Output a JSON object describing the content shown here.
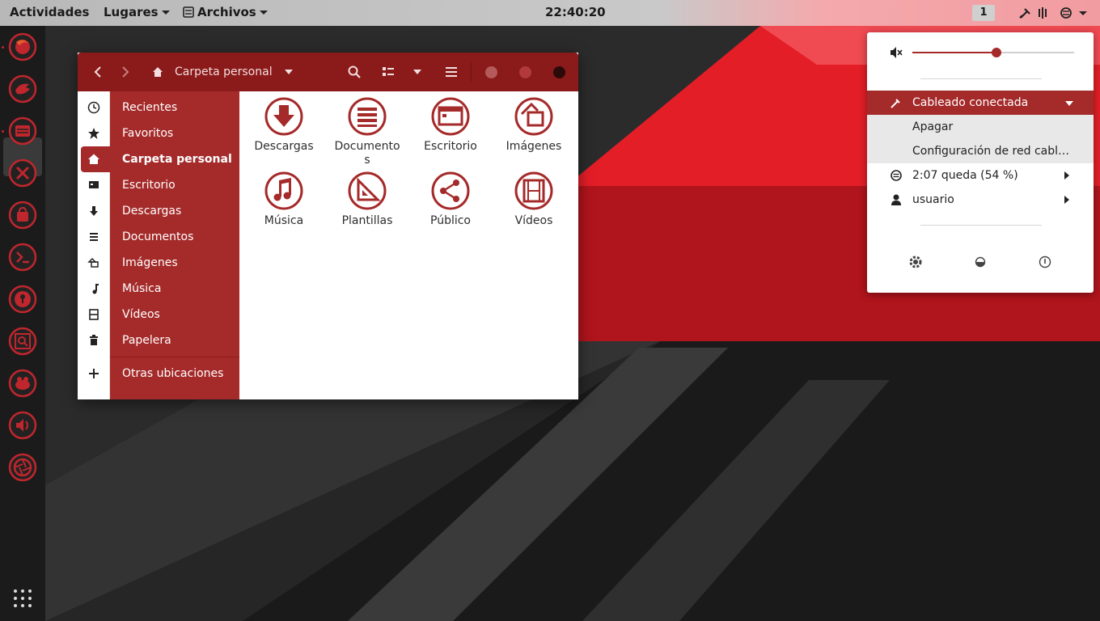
{
  "topbar": {
    "activities": "Actividades",
    "places": "Lugares",
    "app_menu": "Archivos",
    "clock": "22:40:20",
    "workspace": "1"
  },
  "dock": {
    "apps": [
      "firefox-icon",
      "thunderbird-icon",
      "files-icon",
      "tools-icon",
      "store-icon",
      "terminal-icon",
      "keyring-icon",
      "screenshot-icon",
      "gimp-icon",
      "volume-icon",
      "camera-icon"
    ],
    "show_apps": "grid-icon"
  },
  "window": {
    "path_label": "Carpeta personal",
    "sidebar": [
      {
        "label": "Recientes",
        "icon": "clock-icon"
      },
      {
        "label": "Favoritos",
        "icon": "star-icon"
      },
      {
        "label": "Carpeta personal",
        "icon": "home-icon",
        "active": true
      },
      {
        "label": "Escritorio",
        "icon": "desktop-icon"
      },
      {
        "label": "Descargas",
        "icon": "download-icon"
      },
      {
        "label": "Documentos",
        "icon": "document-icon"
      },
      {
        "label": "Imágenes",
        "icon": "image-icon"
      },
      {
        "label": "Música",
        "icon": "music-icon"
      },
      {
        "label": "Vídeos",
        "icon": "video-icon"
      },
      {
        "label": "Papelera",
        "icon": "trash-icon"
      }
    ],
    "other_locations": "Otras ubicaciones",
    "folders": [
      {
        "label": "Descargas",
        "icon": "download-folder-icon"
      },
      {
        "label": "Documentos",
        "icon": "documents-folder-icon"
      },
      {
        "label": "Escritorio",
        "icon": "desktop-folder-icon"
      },
      {
        "label": "Imágenes",
        "icon": "pictures-folder-icon"
      },
      {
        "label": "Música",
        "icon": "music-folder-icon"
      },
      {
        "label": "Plantillas",
        "icon": "templates-folder-icon"
      },
      {
        "label": "Público",
        "icon": "public-folder-icon"
      },
      {
        "label": "Vídeos",
        "icon": "videos-folder-icon"
      }
    ]
  },
  "popover": {
    "volume_percent": 52,
    "network": "Cableado conectada",
    "network_off": "Apagar",
    "network_settings": "Configuración de red cabl…",
    "battery": "2:07 queda (54 %)",
    "user": "usuario"
  },
  "colors": {
    "accent": "#a52a2a",
    "headerbar": "#8b1a1a"
  }
}
